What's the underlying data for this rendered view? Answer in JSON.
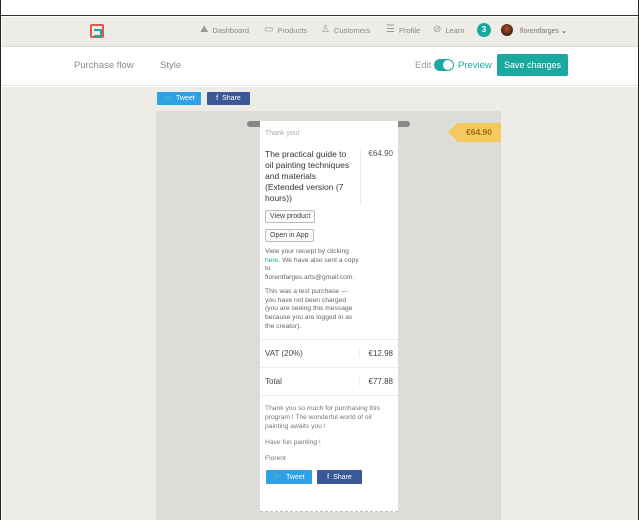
{
  "nav": {
    "items": [
      {
        "label": "Dashboard",
        "icon": "dashboard-icon"
      },
      {
        "label": "Products",
        "icon": "products-icon"
      },
      {
        "label": "Customers",
        "icon": "customers-icon"
      },
      {
        "label": "Profile",
        "icon": "profile-icon"
      },
      {
        "label": "Learn",
        "icon": "compass-icon"
      }
    ],
    "learn_badge": "3",
    "username": "florentfarges"
  },
  "subbar": {
    "tabs": [
      "Purchase flow",
      "Style"
    ],
    "edit_label": "Edit",
    "preview_label": "Preview",
    "save_label": "Save changes"
  },
  "share": {
    "tweet": "Tweet",
    "share": "Share"
  },
  "receipt": {
    "price_tag": "€64.90",
    "thank_you": "Thank you!",
    "product_name": "The practical guide to oil painting techniques and materials (Extended version (7 hours))",
    "product_price": "€64.90",
    "view_product": "View product",
    "open_in_app": "Open in App",
    "receipt_prefix": "View your receipt by clicking",
    "receipt_link": "here",
    "receipt_suffix": ". We have also sent a copy to florentfarges.arts@gmail.com.",
    "test_note": "This was a test purchase — you have not been charged (you are seeing this message because you are logged in as the creator).",
    "vat_label": "VAT (20%)",
    "vat_value": "€12.98",
    "total_label": "Total",
    "total_value": "€77.88",
    "closing_1": "Thank you so much for purchasing this program ! The wonderful world of oil painting awaits you !",
    "closing_2": "Have fun painting !",
    "closing_3": "Florent"
  },
  "colors": {
    "accent": "#1aa9a0",
    "twitter": "#2ea0e6",
    "facebook": "#3b5998",
    "price_tag": "#f6c95e"
  }
}
